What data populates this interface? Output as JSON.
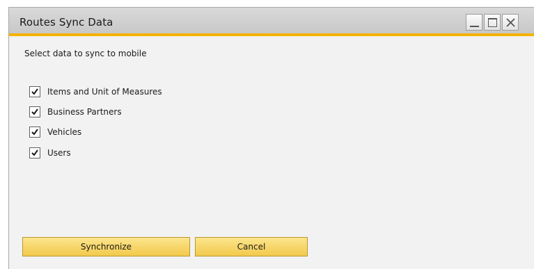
{
  "window": {
    "title": "Routes Sync Data",
    "controls": [
      "minimize-icon",
      "maximize-icon",
      "close-icon"
    ],
    "accent_color": "#f5b400"
  },
  "form": {
    "prompt": "Select data to sync to mobile",
    "options": [
      {
        "label": "Items and Unit of Measures",
        "checked": true
      },
      {
        "label": "Business Partners",
        "checked": true
      },
      {
        "label": "Vehicles",
        "checked": true
      },
      {
        "label": "Users",
        "checked": true
      }
    ]
  },
  "buttons": {
    "synchronize": "Synchronize",
    "cancel": "Cancel",
    "color": "#f7d463"
  }
}
